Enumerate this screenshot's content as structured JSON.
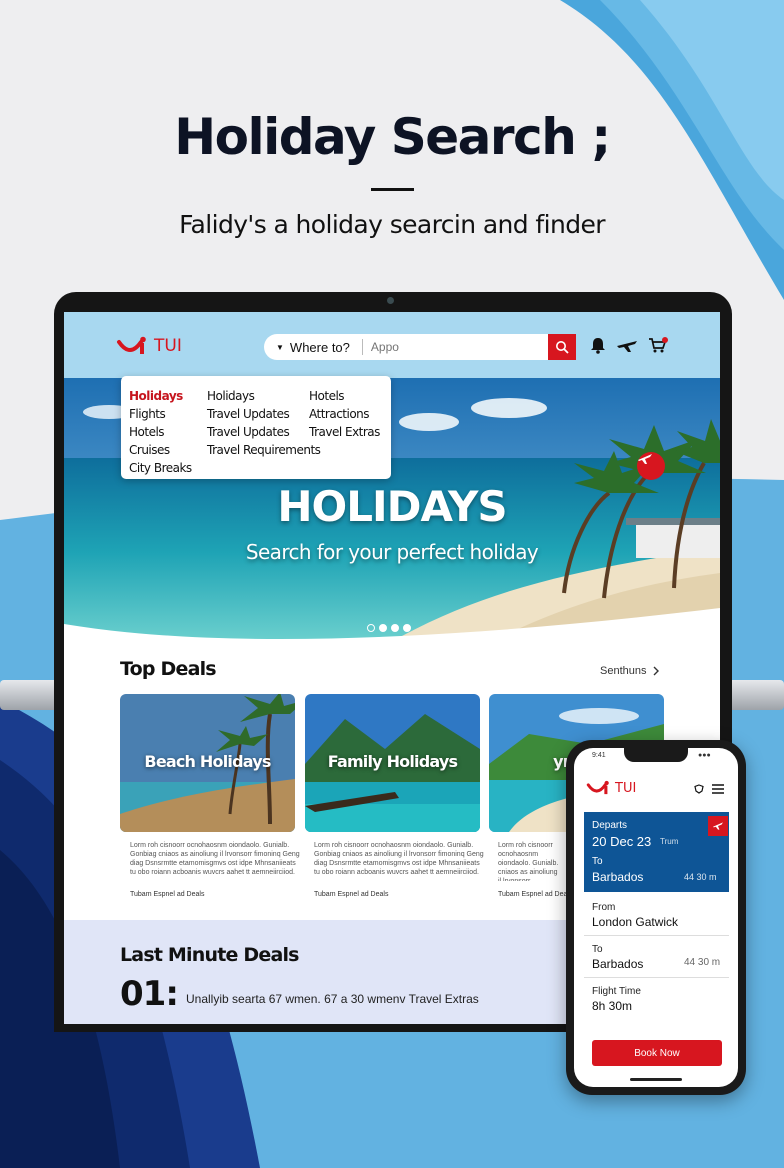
{
  "page": {
    "headline": "Holiday Search",
    "headline_mark": ";",
    "subline": "Falidy's a holiday searcin and finder"
  },
  "header": {
    "logo_text": "TUI",
    "where_label": "Where to?",
    "search_placeholder": "Appo"
  },
  "menu": {
    "col1": [
      "Holidays",
      "Flights",
      "Hotels",
      "Cruises",
      "City Breaks"
    ],
    "col2": [
      "Holidays",
      "Travel Updates",
      "Travel Updates",
      "Travel Requirements"
    ],
    "col3": [
      "Hotels",
      "Attractions",
      "Travel Extras"
    ],
    "active": "Holidays"
  },
  "hero": {
    "title": "HOLIDAYS",
    "subtitle": "Search for your perfect holiday",
    "slides_total": 4,
    "slide_active": 2
  },
  "top_deals": {
    "title": "Top Deals",
    "see_all": "Sеnthuns",
    "cards": [
      {
        "label": "Beach Holidays",
        "text": "Lorm roh cisnoorr ocnohaosnm oiondaolo. Gunialb. Gonbiag cniaos as ainoliung il lrvonsorr fimoninq Geng diag Dsnsrmtte etamomisgmvs ost idpe Mhnsaniieats tu obo roiann acboanis wuvcrs aahet tt aemneiirciiod.",
        "footer": "Tubam Espnel ad Deals"
      },
      {
        "label": "Family Holidays",
        "text": "Lorm roh cisnoorr ocnohaosnm oiondaolo. Gunialb. Gonbiag cniaos as ainoliung il lrvonsorr fimoninq Geng diag Dsnsrmtte etamomisgmvs ost idpe Mhnsaniieats tu obo roiann acboanis wuvcrs aahet tt aemneiirciiod.",
        "footer": "Tubam Espnel ad Deals"
      },
      {
        "label": "ymity",
        "text": "Lorm roh cisnoorr ocnohaosnm oiondaolo. Gunialb. cniaos as ainoliung il lrvonsorr Dsnsrmtte etamomisgmvs ost roiann acboanis wuvcrs aahet",
        "footer": "Tubam Espnel ad Deals"
      }
    ]
  },
  "last_minute": {
    "title": "Last Minute Deals",
    "number": "01:",
    "text": "Unallyib searta 67 wmen. 67 a 30 wmenv Travel Extras"
  },
  "phone": {
    "status_time": "9:41",
    "status_right": "●●●",
    "logo_text": "TUI",
    "departs_label": "Departs",
    "departs_value": "20 Dec 23",
    "departs_time": "Trum",
    "to_label": "To",
    "to_value": "Barbados",
    "to_side": "44 30 m",
    "from_label": "From",
    "from_value": "London Gatwick",
    "to2_label": "To",
    "to2_value": "Barbados",
    "to2_side": "44 30 m",
    "flight_time_label": "Flight Time",
    "flight_time_value": "8h 30m",
    "book_label": "Book Now"
  },
  "colors": {
    "brand_red": "#d7161f",
    "header_blue": "#a8d8f0",
    "phone_panel": "#0e5596",
    "last_minute_bg": "#e0e5f7"
  }
}
